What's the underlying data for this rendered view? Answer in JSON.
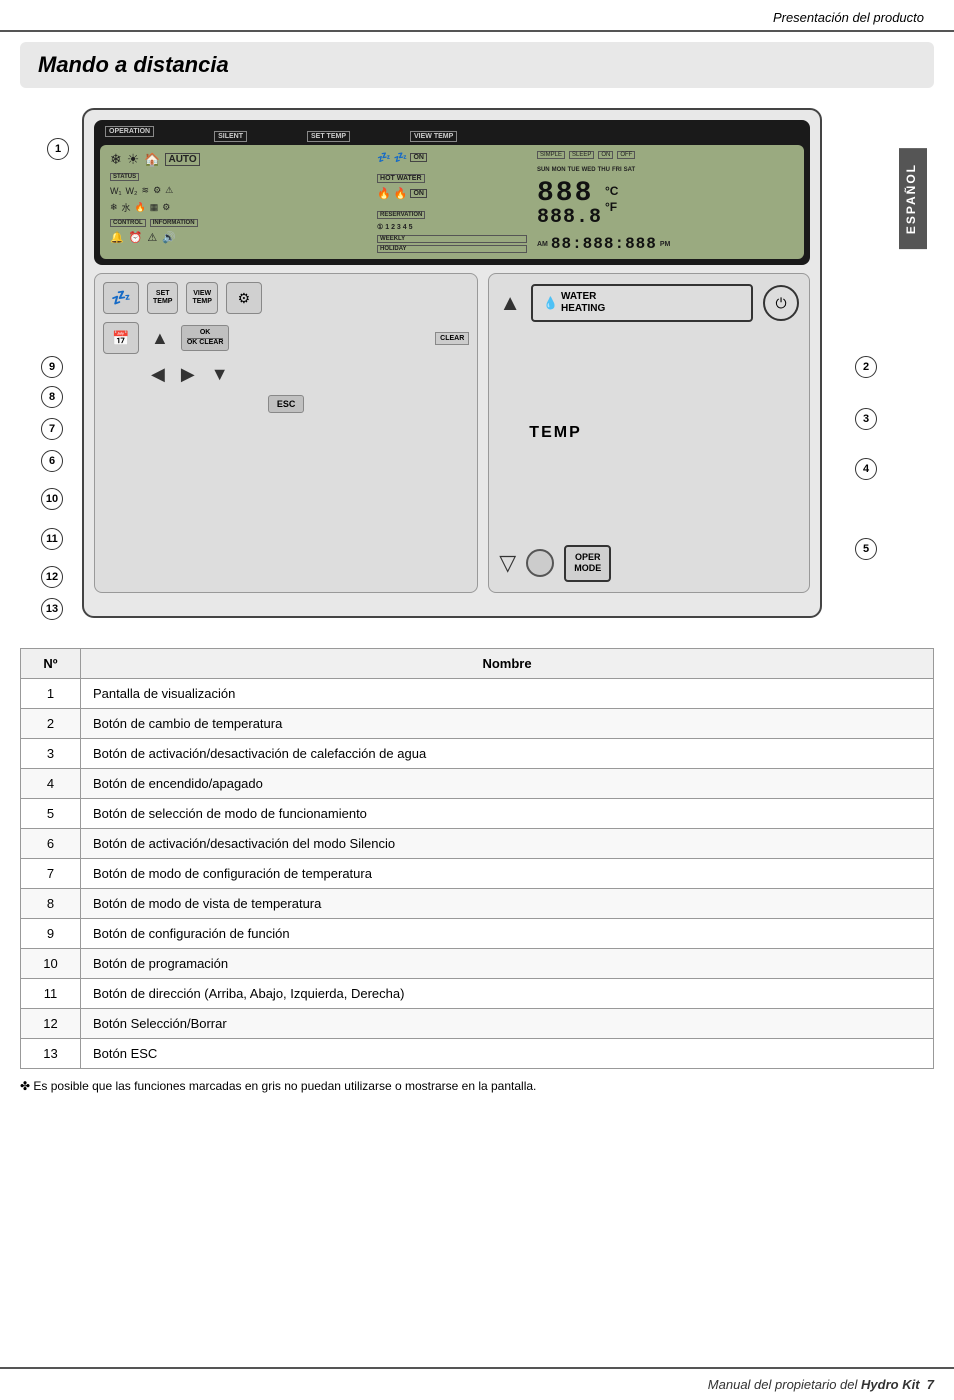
{
  "header": {
    "title": "Presentación del producto"
  },
  "page_title": {
    "text": "Mando a distancia"
  },
  "sidebar": {
    "label": "ESPAÑOL"
  },
  "remote": {
    "display_labels": {
      "operation": "OPERATION",
      "silent": "SILENT",
      "set_temp": "SET TEMP",
      "view_temp": "VIEW TEMP",
      "status": "STATUS",
      "hot_water": "HOT WATER",
      "control": "CONTROL",
      "information": "INFORMATION",
      "reservation": "RESERVATION",
      "simple": "SIMPLE",
      "sleep": "SLEEP",
      "on": "ON",
      "off": "OFF",
      "weekly": "WEEKLY",
      "holiday": "HOLIDAY",
      "am": "AM",
      "pm": "PM",
      "auto": "AUTO",
      "on2": "ON"
    },
    "days": [
      "SUN",
      "MON",
      "TUE",
      "WED",
      "THU",
      "FRI",
      "SAT"
    ],
    "numbers": "1 2 3 4 5",
    "seg_display1": "888",
    "seg_display2": "888.8",
    "seg_time": "88:888:888",
    "cf_c": "°C",
    "cf_f": "°F",
    "buttons": {
      "set_temp": "SET\nTEMP",
      "view_temp": "VIEW\nTEMP",
      "ok_clear": "OK\nCLEAR",
      "esc": "ESC",
      "water_heating": "WATER\nHEATING",
      "temp": "TEMP",
      "oper_mode": "OPER\nMODE"
    }
  },
  "callout_numbers": {
    "left": [
      "①",
      "⑨",
      "⑧",
      "⑦",
      "⑥",
      "⑩",
      "⑪",
      "⑫",
      "⑬"
    ],
    "right": [
      "②",
      "③",
      "④",
      "⑤"
    ]
  },
  "table": {
    "col_n": "Nº",
    "col_name": "Nombre",
    "rows": [
      {
        "n": "1",
        "name": "Pantalla de visualización"
      },
      {
        "n": "2",
        "name": "Botón de cambio de temperatura"
      },
      {
        "n": "3",
        "name": "Botón de activación/desactivación de calefacción de agua"
      },
      {
        "n": "4",
        "name": "Botón de encendido/apagado"
      },
      {
        "n": "5",
        "name": "Botón de selección de modo de funcionamiento"
      },
      {
        "n": "6",
        "name": "Botón de activación/desactivación del modo Silencio"
      },
      {
        "n": "7",
        "name": "Botón de modo de configuración de temperatura"
      },
      {
        "n": "8",
        "name": "Botón de modo de vista de temperatura"
      },
      {
        "n": "9",
        "name": "Botón de configuración de función"
      },
      {
        "n": "10",
        "name": "Botón de programación"
      },
      {
        "n": "11",
        "name": "Botón de dirección (Arriba, Abajo, Izquierda, Derecha)"
      },
      {
        "n": "12",
        "name": "Botón Selección/Borrar"
      },
      {
        "n": "13",
        "name": "Botón ESC"
      }
    ]
  },
  "note": {
    "symbol": "✤",
    "text": "Es posible que las funciones marcadas en gris no puedan utilizarse o mostrarse en la pantalla."
  },
  "footer": {
    "text": "Manual del propietario del",
    "brand": "Hydro Kit",
    "page": "7"
  }
}
